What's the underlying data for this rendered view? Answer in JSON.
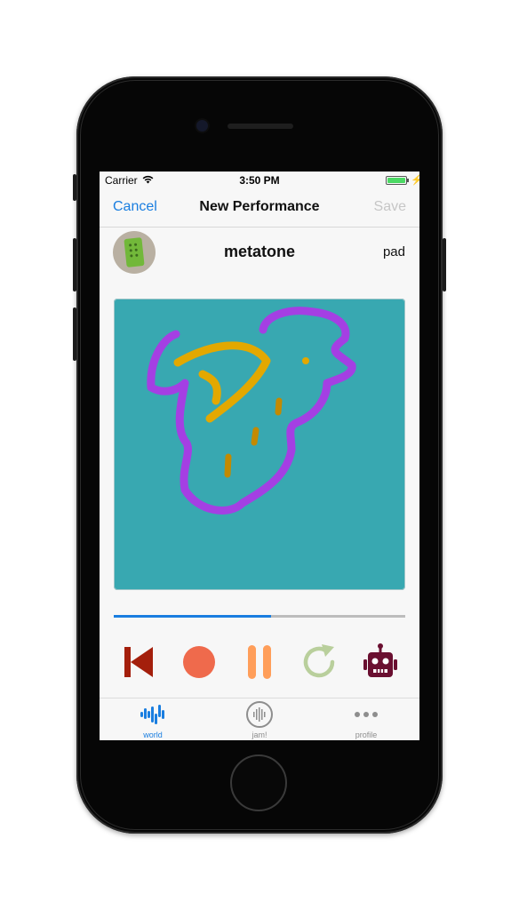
{
  "status_bar": {
    "carrier": "Carrier",
    "time": "3:50 PM",
    "battery_color": "#4cd964"
  },
  "nav": {
    "cancel_label": "Cancel",
    "title": "New Performance",
    "save_label": "Save"
  },
  "performance": {
    "name": "metatone",
    "type": "pad",
    "playback_progress": 0.54
  },
  "pad": {
    "background_color": "#38a8b1"
  },
  "controls": [
    {
      "name": "rewind",
      "icon": "skip-back-icon",
      "color": "#a41f0c"
    },
    {
      "name": "record",
      "icon": "record-circle-icon",
      "color": "#ef6a4c"
    },
    {
      "name": "pause",
      "icon": "pause-icon",
      "color": "#ff9e5a"
    },
    {
      "name": "loop",
      "icon": "refresh-icon",
      "color": "#b9cf9c"
    },
    {
      "name": "robot",
      "icon": "robot-icon",
      "color": "#6a0f30"
    }
  ],
  "tabs": [
    {
      "label": "world",
      "icon": "waveform-world-icon",
      "active": true,
      "color": "#1a7ee0"
    },
    {
      "label": "jam!",
      "icon": "microphone-waveform-icon",
      "active": false,
      "color": "#8e8e8e"
    },
    {
      "label": "profile",
      "icon": "ellipsis-icon",
      "active": false,
      "color": "#8e8e8e"
    }
  ]
}
